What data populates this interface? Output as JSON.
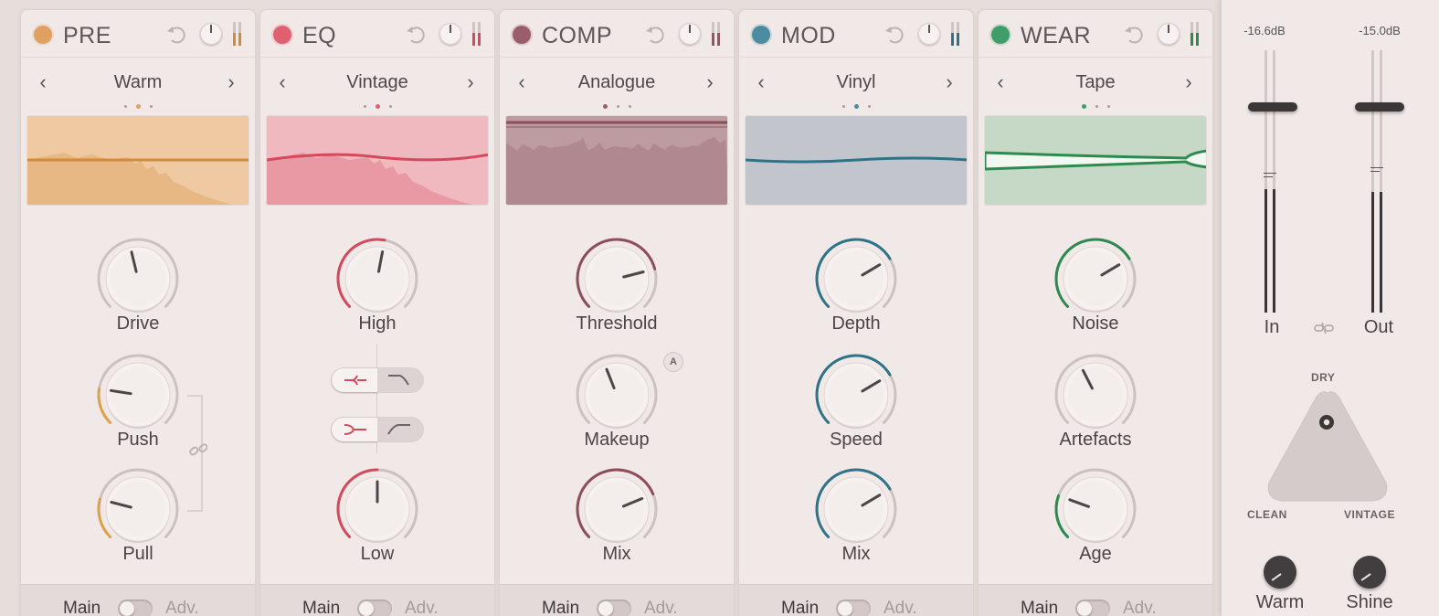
{
  "modules": [
    {
      "id": "pre",
      "title": "PRE",
      "color": "#e0a060",
      "preset": "Warm",
      "dot": 1,
      "graph_bg": "#eec9a2",
      "graph_line": "#d68a36",
      "meter_color": "#d68a36",
      "knobs": [
        "Drive",
        "Push",
        "Pull"
      ],
      "knob_values": [
        0.45,
        0.2,
        0.22
      ],
      "footer_main": "Main",
      "footer_adv": "Adv."
    },
    {
      "id": "eq",
      "title": "EQ",
      "color": "#e06070",
      "preset": "Vintage",
      "dot": 1,
      "graph_bg": "#f0b9c0",
      "graph_line": "#d5495b",
      "meter_color": "#d5495b",
      "knobs": [
        "High",
        "Low"
      ],
      "knob_values": [
        0.54,
        0.5
      ],
      "footer_main": "Main",
      "footer_adv": "Adv."
    },
    {
      "id": "comp",
      "title": "COMP",
      "color": "#9a5e6a",
      "preset": "Analogue",
      "dot": 0,
      "graph_bg": "#bc9ba1",
      "graph_line": "#8d4e5a",
      "meter_color": "#a0505e",
      "knobs": [
        "Threshold",
        "Makeup",
        "Mix"
      ],
      "knob_values": [
        0.78,
        0.42,
        0.75
      ],
      "footer_main": "Main",
      "footer_adv": "Adv.",
      "auto_badge": "A"
    },
    {
      "id": "mod",
      "title": "MOD",
      "color": "#4a8da0",
      "preset": "Vinyl",
      "dot": 1,
      "graph_bg": "#c2c6cc",
      "graph_line": "#2d7489",
      "meter_color": "#2d7489",
      "knobs": [
        "Depth",
        "Speed",
        "Mix"
      ],
      "knob_values": [
        0.72,
        0.72,
        0.72
      ],
      "footer_main": "Main",
      "footer_adv": "Adv."
    },
    {
      "id": "wear",
      "title": "WEAR",
      "color": "#3f9e68",
      "preset": "Tape",
      "dot": 0,
      "graph_bg": "#c5d9c6",
      "graph_line": "#2d8a4f",
      "meter_color": "#2d8a4f",
      "knobs": [
        "Noise",
        "Artefacts",
        "Age"
      ],
      "knob_values": [
        0.72,
        0.4,
        0.24
      ],
      "footer_main": "Main",
      "footer_adv": "Adv."
    }
  ],
  "output": {
    "in_db": "-16.6dB",
    "out_db": "-15.0dB",
    "in_label": "In",
    "out_label": "Out",
    "in_level": 0.47,
    "out_level": 0.46,
    "dry_label": "DRY",
    "clean_label": "CLEAN",
    "vintage_label": "VINTAGE",
    "warm_label": "Warm",
    "shine_label": "Shine"
  },
  "icons": {
    "undo": "undo-icon",
    "link": "link-icon",
    "prev": "chevron-left-icon",
    "next": "chevron-right-icon"
  },
  "nav_prev": "‹",
  "nav_next": "›"
}
